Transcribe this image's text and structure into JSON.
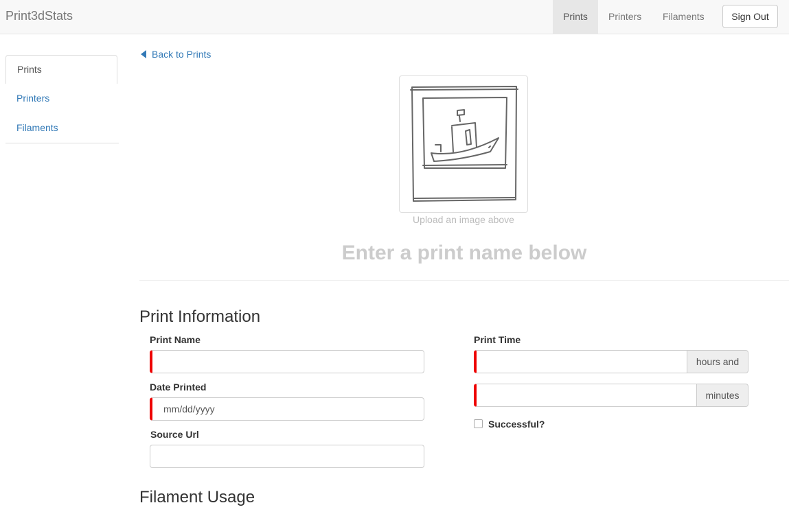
{
  "navbar": {
    "brand": "Print3dStats",
    "items": [
      "Prints",
      "Printers",
      "Filaments"
    ],
    "sign_out": "Sign Out"
  },
  "sidebar": {
    "items": [
      "Prints",
      "Printers",
      "Filaments"
    ]
  },
  "main": {
    "back_link": "Back to Prints",
    "upload_caption": "Upload an image above",
    "print_title_placeholder": "Enter a print name below",
    "print_info_title": "Print Information",
    "filament_usage_title": "Filament Usage",
    "fields": {
      "print_name_label": "Print Name",
      "print_name_value": "",
      "date_printed_label": "Date Printed",
      "date_printed_value": "mm/dd/yyyy",
      "source_url_label": "Source Url",
      "source_url_value": "",
      "print_time_label": "Print Time",
      "hours_value": "",
      "hours_addon": "hours and",
      "minutes_value": "",
      "minutes_addon": "minutes",
      "successful_label": "Successful?"
    }
  }
}
